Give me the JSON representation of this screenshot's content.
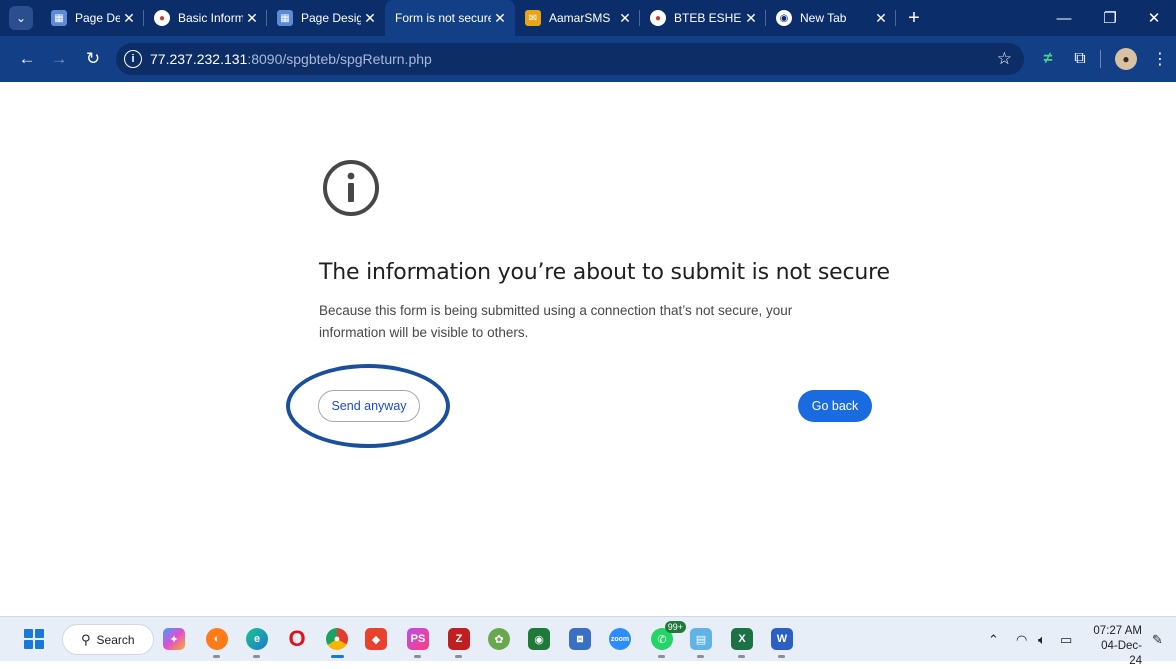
{
  "browser": {
    "tabs": [
      {
        "title": "Page Designer",
        "favicon": "page-designer-icon",
        "fav_color": "#5f8bd6",
        "active": false
      },
      {
        "title": "Basic Informat",
        "favicon": "bteb-seal-icon",
        "fav_color": "#c83a3a",
        "active": false
      },
      {
        "title": "Page Designer",
        "favicon": "page-designer-icon",
        "fav_color": "#5f8bd6",
        "active": false
      },
      {
        "title": "Form is not secure",
        "favicon": "",
        "fav_color": "",
        "active": true
      },
      {
        "title": "AamarSMS",
        "favicon": "mail-envelope-icon",
        "fav_color": "#e6a51a",
        "active": false
      },
      {
        "title": "BTEB ESHEBA",
        "favicon": "bteb-seal-icon",
        "fav_color": "#c83a3a",
        "active": false
      },
      {
        "title": "New Tab",
        "favicon": "chrome-icon",
        "fav_color": "#ffffff",
        "active": false
      }
    ],
    "url": {
      "host": "77.237.232.131",
      "rest": ":8090/spgbteb/spgReturn.php"
    }
  },
  "page": {
    "heading": "The information you’re about to submit is not secure",
    "description": "Because this form is being submitted using a connection that’s not secure, your information will be visible to others.",
    "send_anyway": "Send anyway",
    "go_back": "Go back"
  },
  "taskbar": {
    "search_label": "Search",
    "notification_badge": "99+",
    "time": "07:27 AM",
    "date": "04-Dec-24"
  },
  "colors": {
    "chrome_tabstrip": "#0b2e6b",
    "chrome_toolbar": "#133f86",
    "primary_button": "#1a6be0",
    "highlight_ring": "#1a4f9c"
  }
}
